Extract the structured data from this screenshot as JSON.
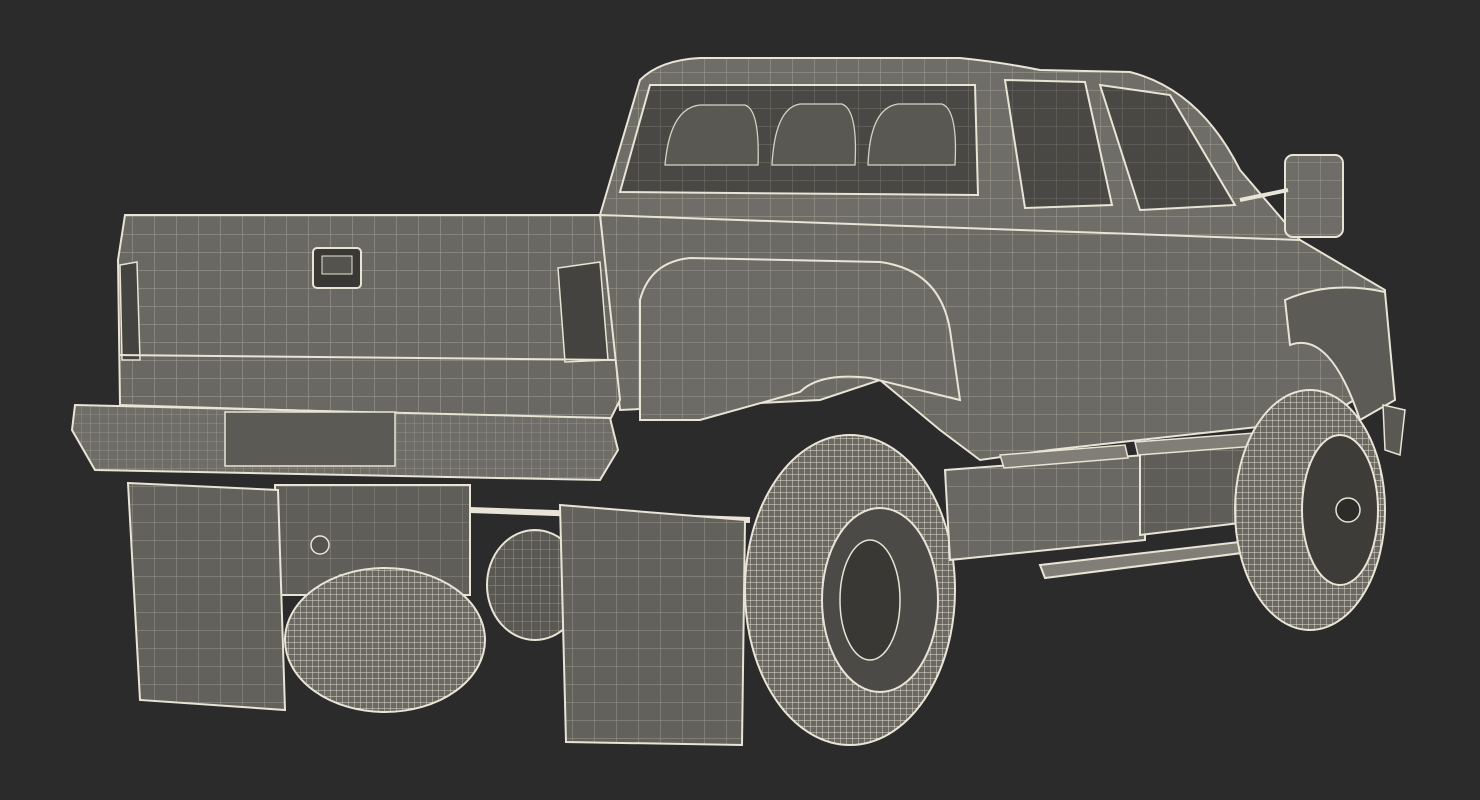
{
  "scene": {
    "subject": "wireframe-pickup-truck-render",
    "background_color": "#2b2b2b",
    "body_color": "#6e6c66",
    "wire_color": "#e8e4d6",
    "dark_detail_color": "#3a3834"
  }
}
